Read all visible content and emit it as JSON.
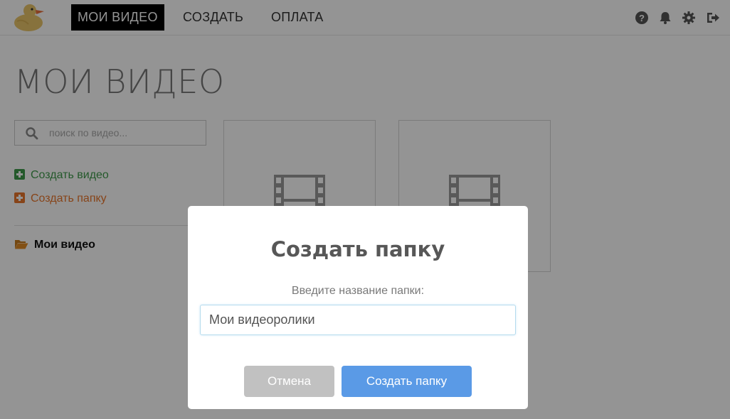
{
  "nav": {
    "items": [
      {
        "label": "МОИ ВИДЕО"
      },
      {
        "label": "СОЗДАТЬ"
      },
      {
        "label": "ОПЛАТА"
      }
    ],
    "icons": [
      "help-icon",
      "bell-icon",
      "gear-icon",
      "logout-icon"
    ]
  },
  "page": {
    "title": "МОИ ВИДЕО"
  },
  "sidebar": {
    "search_placeholder": "поиск по видео...",
    "create_video": "Создать видео",
    "create_folder": "Создать папку",
    "folder_name": "Мои видео"
  },
  "modal": {
    "title": "Создать папку",
    "label": "Введите название папки:",
    "input_value": "Мои видеоролики",
    "cancel": "Отмена",
    "confirm": "Создать папку"
  },
  "colors": {
    "accent_blue": "#5a9ae6",
    "create_video_green": "#3f9a4a",
    "create_folder_orange": "#e8762b",
    "overlay": "rgba(0,0,0,0.42)"
  }
}
